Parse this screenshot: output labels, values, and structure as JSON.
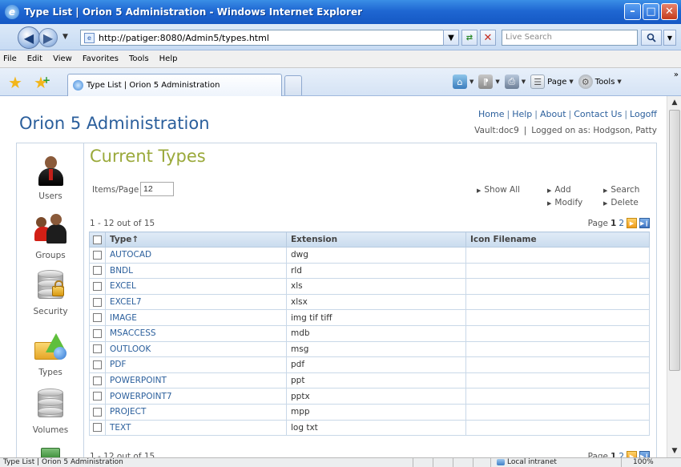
{
  "window": {
    "title": "Type List | Orion 5 Administration - Windows Internet Explorer",
    "minimize": "–",
    "maximize": "□",
    "close": "✕"
  },
  "address_bar": {
    "url": "http://patiger:8080/Admin5/types.html",
    "search_placeholder": "Live Search"
  },
  "menu": [
    "File",
    "Edit",
    "View",
    "Favorites",
    "Tools",
    "Help"
  ],
  "tabs": {
    "active_label": "Type List | Orion 5 Administration"
  },
  "command_bar": {
    "page_label": "Page",
    "tools_label": "Tools"
  },
  "site": {
    "title": "Orion 5 Administration",
    "top_links": [
      "Home",
      "Help",
      "About",
      "Contact Us",
      "Logoff"
    ],
    "vault": "Vault:doc9",
    "logged_on": "Logged on as: Hodgson, Patty"
  },
  "sidebar": {
    "items": [
      {
        "label": "Users",
        "icon": "user-icon"
      },
      {
        "label": "Groups",
        "icon": "group-icon"
      },
      {
        "label": "Security",
        "icon": "security-database-icon"
      },
      {
        "label": "Types",
        "icon": "types-icon"
      },
      {
        "label": "Volumes",
        "icon": "volumes-database-icon"
      }
    ]
  },
  "types_panel": {
    "heading": "Current Types",
    "items_per_page_label": "Items/Page",
    "items_per_page_value": "12",
    "actions": {
      "show_all": "Show All",
      "add": "Add",
      "search": "Search",
      "modify": "Modify",
      "delete": "Delete"
    },
    "count_text": "1 - 12 out of 15",
    "pager": {
      "label": "Page",
      "current": "1",
      "next": "2"
    },
    "columns": [
      "Type↑",
      "Extension",
      "Icon Filename"
    ],
    "rows": [
      {
        "type": "AUTOCAD",
        "extension": "dwg",
        "icon_filename": ""
      },
      {
        "type": "BNDL",
        "extension": "rld",
        "icon_filename": ""
      },
      {
        "type": "EXCEL",
        "extension": "xls",
        "icon_filename": ""
      },
      {
        "type": "EXCEL7",
        "extension": "xlsx",
        "icon_filename": ""
      },
      {
        "type": "IMAGE",
        "extension": "img tif tiff",
        "icon_filename": ""
      },
      {
        "type": "MSACCESS",
        "extension": "mdb",
        "icon_filename": ""
      },
      {
        "type": "OUTLOOK",
        "extension": "msg",
        "icon_filename": ""
      },
      {
        "type": "PDF",
        "extension": "pdf",
        "icon_filename": ""
      },
      {
        "type": "POWERPOINT",
        "extension": "ppt",
        "icon_filename": ""
      },
      {
        "type": "POWERPOINT7",
        "extension": "pptx",
        "icon_filename": ""
      },
      {
        "type": "PROJECT",
        "extension": "mpp",
        "icon_filename": ""
      },
      {
        "type": "TEXT",
        "extension": "log txt",
        "icon_filename": ""
      }
    ]
  },
  "status_bar": {
    "text": "Type List | Orion 5 Administration",
    "zone": "Local intranet",
    "zoom": "100%"
  },
  "colors": {
    "title_blue": "#2b5f9c",
    "heading_olive": "#9aa93a",
    "ie_titlebar": "#1f67d2"
  }
}
